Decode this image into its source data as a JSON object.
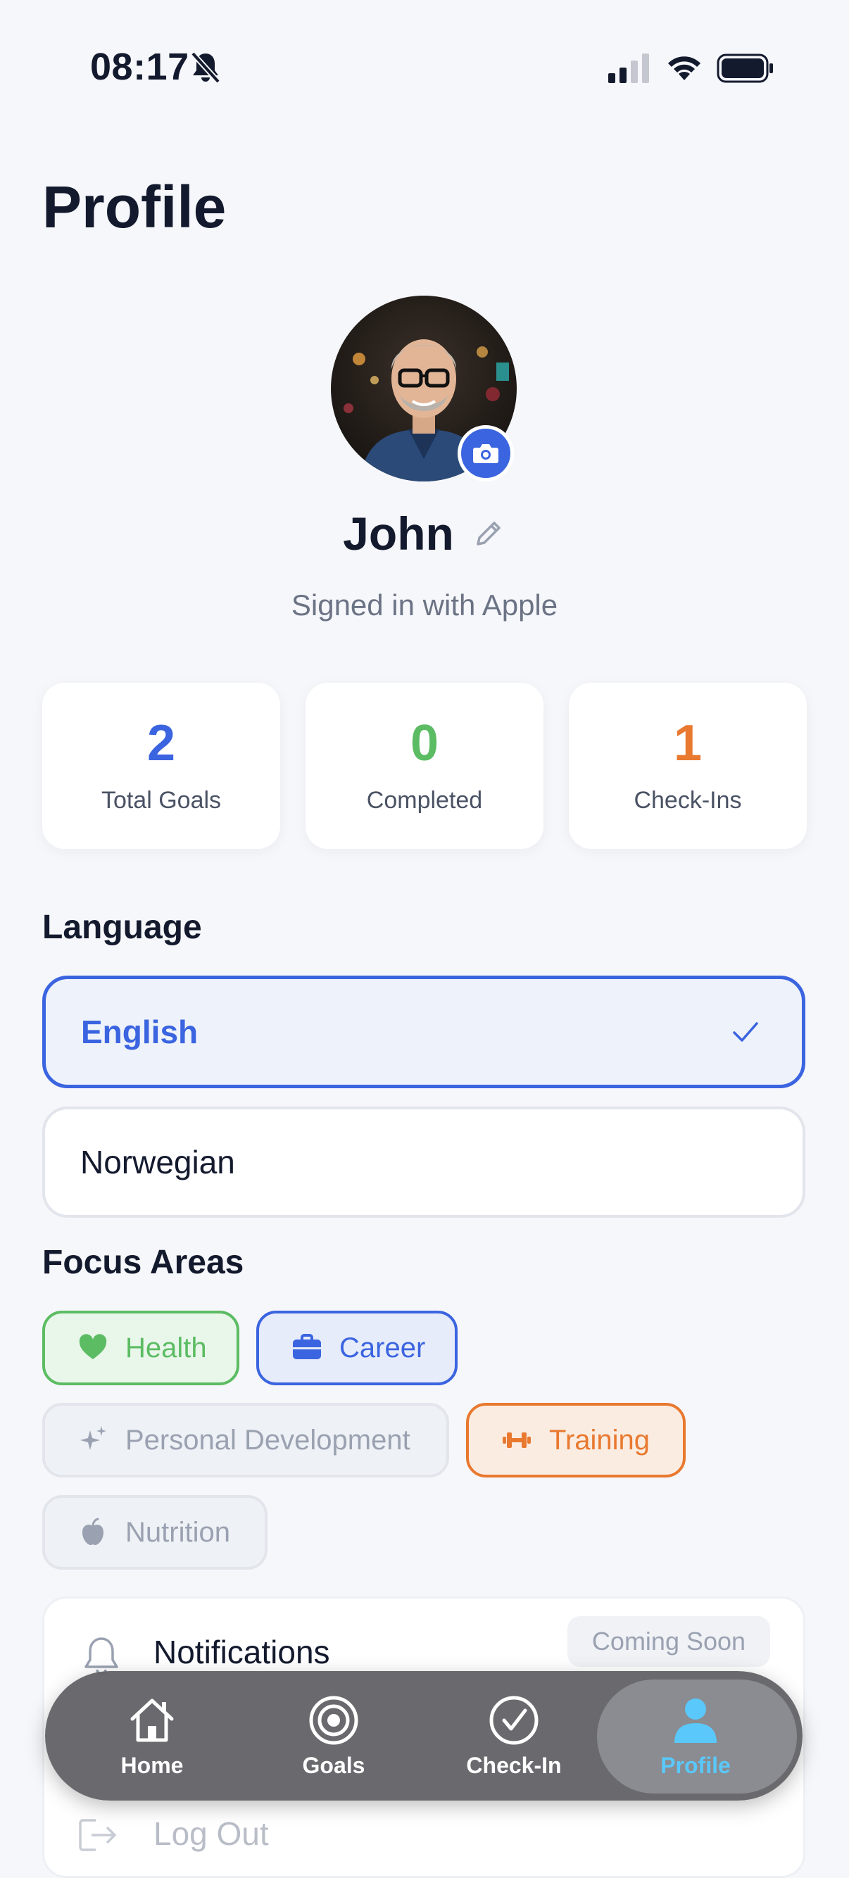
{
  "status_bar": {
    "time": "08:17"
  },
  "page": {
    "title": "Profile"
  },
  "profile": {
    "name": "John",
    "signed_in": "Signed in with Apple"
  },
  "stats": [
    {
      "value": "2",
      "label": "Total Goals",
      "color": "#3b64e0"
    },
    {
      "value": "0",
      "label": "Completed",
      "color": "#5cbc63"
    },
    {
      "value": "1",
      "label": "Check-Ins",
      "color": "#e8792f"
    }
  ],
  "language": {
    "heading": "Language",
    "options": [
      {
        "label": "English",
        "selected": true
      },
      {
        "label": "Norwegian",
        "selected": false
      }
    ]
  },
  "focus_areas": {
    "heading": "Focus Areas",
    "chips": [
      {
        "label": "Health",
        "icon": "heart-icon",
        "selected": true,
        "color": "#5cbc63"
      },
      {
        "label": "Career",
        "icon": "briefcase-icon",
        "selected": true,
        "color": "#3b64e0"
      },
      {
        "label": "Personal Development",
        "icon": "sparkles-icon",
        "selected": false,
        "color": "#9aa1b1"
      },
      {
        "label": "Training",
        "icon": "dumbbell-icon",
        "selected": true,
        "color": "#e8792f"
      },
      {
        "label": "Nutrition",
        "icon": "apple-icon",
        "selected": false,
        "color": "#9aa1b1"
      }
    ]
  },
  "settings": {
    "notifications_label": "Notifications",
    "coming_soon": "Coming Soon",
    "logout_label": "Log Out"
  },
  "tabbar": {
    "tabs": [
      {
        "label": "Home",
        "icon": "home-icon"
      },
      {
        "label": "Goals",
        "icon": "target-icon"
      },
      {
        "label": "Check-In",
        "icon": "check-circle-icon"
      },
      {
        "label": "Profile",
        "icon": "person-icon",
        "active": true
      }
    ],
    "active_color": "#5ac8fa"
  }
}
